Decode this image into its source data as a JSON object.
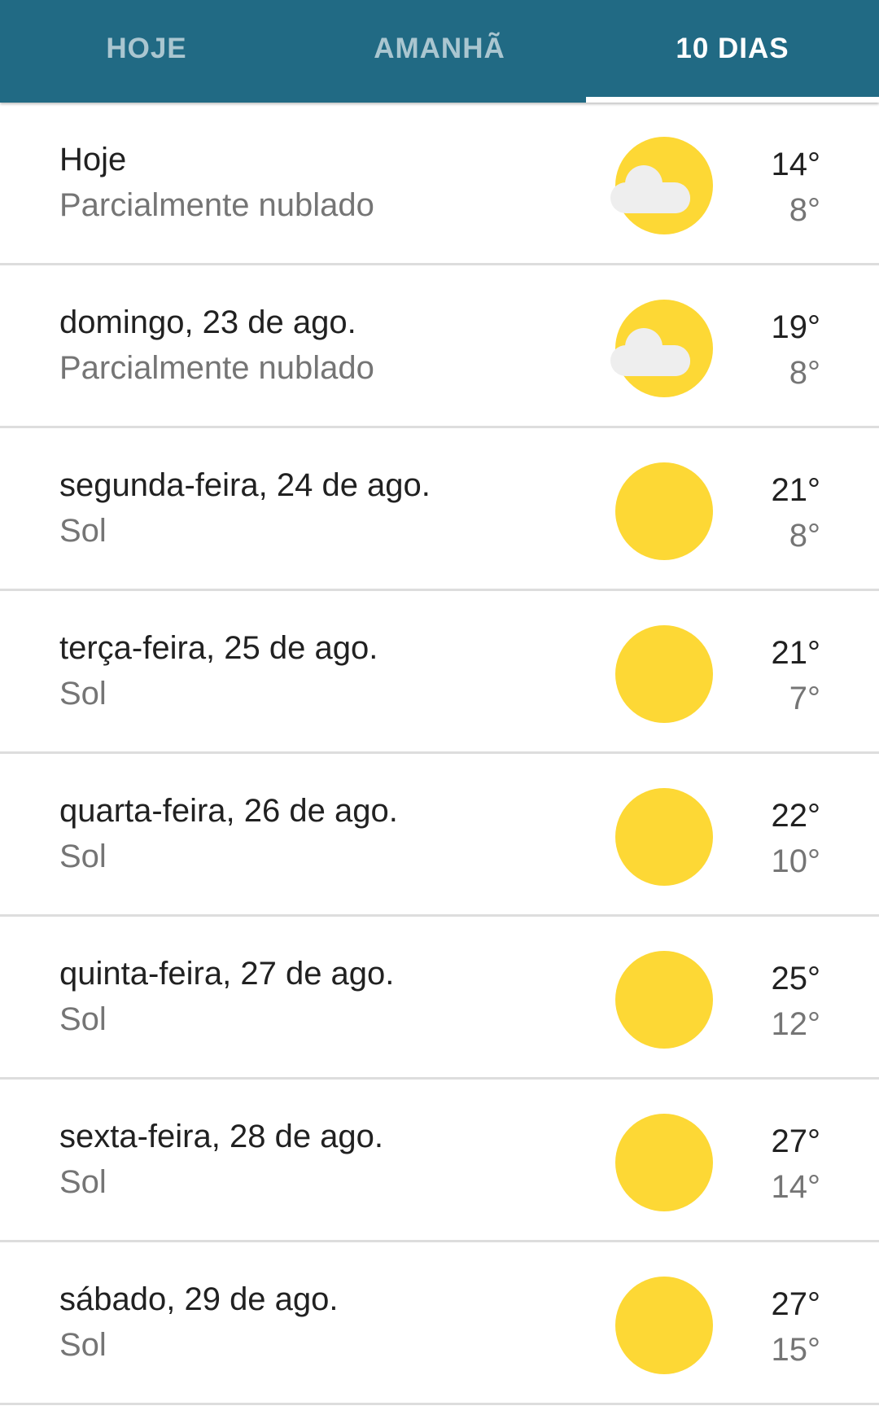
{
  "tabs": [
    {
      "label": "HOJE",
      "active": false
    },
    {
      "label": "AMANHÃ",
      "active": false
    },
    {
      "label": "10 DIAS",
      "active": true
    }
  ],
  "colors": {
    "header": "#216a84",
    "sun": "#fdd835",
    "cloud": "#eeeeee"
  },
  "forecast": [
    {
      "day": "Hoje",
      "condition": "Parcialmente nublado",
      "icon": "partly-cloudy-icon",
      "high": "14°",
      "low": "8°"
    },
    {
      "day": "domingo, 23 de ago.",
      "condition": "Parcialmente nublado",
      "icon": "partly-cloudy-icon",
      "high": "19°",
      "low": "8°"
    },
    {
      "day": "segunda-feira, 24 de ago.",
      "condition": "Sol",
      "icon": "sun-icon",
      "high": "21°",
      "low": "8°"
    },
    {
      "day": "terça-feira, 25 de ago.",
      "condition": "Sol",
      "icon": "sun-icon",
      "high": "21°",
      "low": "7°"
    },
    {
      "day": "quarta-feira, 26 de ago.",
      "condition": "Sol",
      "icon": "sun-icon",
      "high": "22°",
      "low": "10°"
    },
    {
      "day": "quinta-feira, 27 de ago.",
      "condition": "Sol",
      "icon": "sun-icon",
      "high": "25°",
      "low": "12°"
    },
    {
      "day": "sexta-feira, 28 de ago.",
      "condition": "Sol",
      "icon": "sun-icon",
      "high": "27°",
      "low": "14°"
    },
    {
      "day": "sábado, 29 de ago.",
      "condition": "Sol",
      "icon": "sun-icon",
      "high": "27°",
      "low": "15°"
    }
  ]
}
